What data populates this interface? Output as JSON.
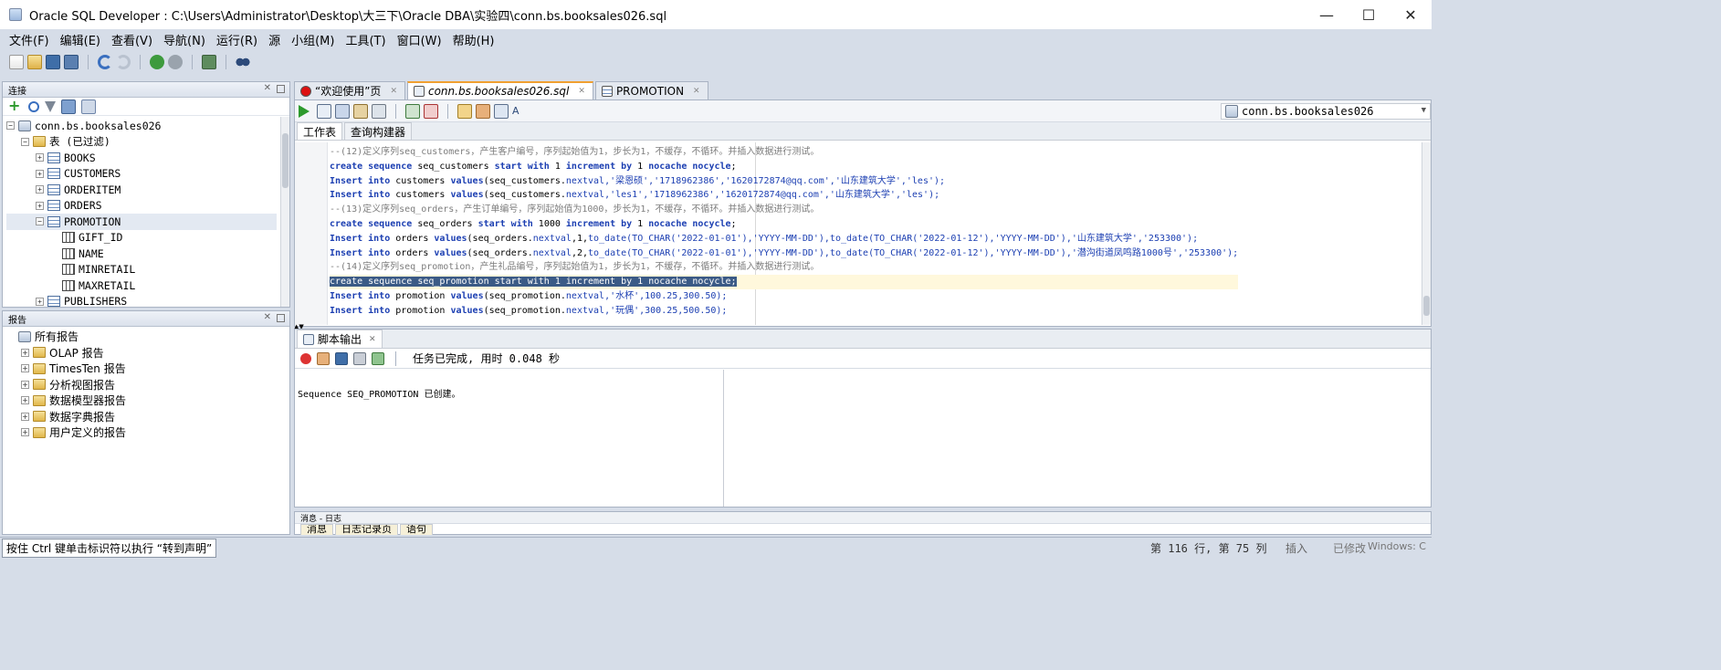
{
  "window": {
    "title": "Oracle SQL Developer : C:\\Users\\Administrator\\Desktop\\大三下\\Oracle DBA\\实验四\\conn.bs.booksales026.sql",
    "minimize": "—",
    "maximize": "☐",
    "close": "✕"
  },
  "menu": [
    "文件(F)",
    "编辑(E)",
    "查看(V)",
    "导航(N)",
    "运行(R)",
    "源",
    "小组(M)",
    "工具(T)",
    "窗口(W)",
    "帮助(H)"
  ],
  "connections_panel": {
    "title": "连接",
    "tree": [
      {
        "label": "conn.bs.booksales026",
        "level": 0,
        "expander": "−",
        "icon": "database-icon"
      },
      {
        "label": "表 (已过滤)",
        "level": 1,
        "expander": "−",
        "icon": "folder-icon"
      },
      {
        "label": "BOOKS",
        "level": 2,
        "expander": "+",
        "icon": "table-icon"
      },
      {
        "label": "CUSTOMERS",
        "level": 2,
        "expander": "+",
        "icon": "table-icon"
      },
      {
        "label": "ORDERITEM",
        "level": 2,
        "expander": "+",
        "icon": "table-icon"
      },
      {
        "label": "ORDERS",
        "level": 2,
        "expander": "+",
        "icon": "table-icon"
      },
      {
        "label": "PROMOTION",
        "level": 2,
        "expander": "−",
        "icon": "table-icon",
        "selected": true
      },
      {
        "label": "GIFT_ID",
        "level": 3,
        "expander": "",
        "icon": "column-icon"
      },
      {
        "label": "NAME",
        "level": 3,
        "expander": "",
        "icon": "column-icon"
      },
      {
        "label": "MINRETAIL",
        "level": 3,
        "expander": "",
        "icon": "column-icon"
      },
      {
        "label": "MAXRETAIL",
        "level": 3,
        "expander": "",
        "icon": "column-icon"
      },
      {
        "label": "PUBLISHERS",
        "level": 2,
        "expander": "+",
        "icon": "table-icon"
      }
    ]
  },
  "reports_panel": {
    "title": "报告",
    "tree": [
      {
        "label": "所有报告",
        "level": 0,
        "expander": "",
        "icon": "report-icon"
      },
      {
        "label": "OLAP 报告",
        "level": 1,
        "expander": "+",
        "icon": "folder-icon"
      },
      {
        "label": "TimesTen 报告",
        "level": 1,
        "expander": "+",
        "icon": "folder-icon"
      },
      {
        "label": "分析视图报告",
        "level": 1,
        "expander": "+",
        "icon": "folder-icon"
      },
      {
        "label": "数据模型器报告",
        "level": 1,
        "expander": "+",
        "icon": "folder-icon"
      },
      {
        "label": "数据字典报告",
        "level": 1,
        "expander": "+",
        "icon": "folder-icon"
      },
      {
        "label": "用户定义的报告",
        "level": 1,
        "expander": "+",
        "icon": "folder-icon"
      }
    ]
  },
  "doc_tabs": [
    {
      "label": "“欢迎使用”页",
      "icon": "oracle-icon",
      "active": false
    },
    {
      "label": "conn.bs.booksales026.sql",
      "icon": "sql-worksheet-icon",
      "active": true
    },
    {
      "label": "PROMOTION",
      "icon": "table-icon",
      "active": false
    }
  ],
  "editor": {
    "connection": "conn.bs.booksales026",
    "subtabs": [
      "工作表",
      "查询构建器"
    ],
    "lines": [
      [
        {
          "t": "--(12)定义序列seq_customers，产生客户编号，序列起始值为1，步长为1，不缓存，不循环。并插入数据进行测试。",
          "c": "cmt"
        }
      ],
      [
        {
          "t": "create sequence",
          "c": "kw"
        },
        {
          "t": " seq_customers ",
          "c": "plain"
        },
        {
          "t": "start with",
          "c": "kw"
        },
        {
          "t": " 1 ",
          "c": "plain"
        },
        {
          "t": "increment by",
          "c": "kw"
        },
        {
          "t": " 1 ",
          "c": "plain"
        },
        {
          "t": "nocache nocycle",
          "c": "kw"
        },
        {
          "t": ";",
          "c": "plain"
        }
      ],
      [
        {
          "t": "Insert into",
          "c": "kw"
        },
        {
          "t": " customers ",
          "c": "plain"
        },
        {
          "t": "values",
          "c": "kw"
        },
        {
          "t": "(seq_customers.",
          "c": "plain"
        },
        {
          "t": "nextval",
          "c": "fn"
        },
        {
          "t": ",'梁恩硕','1718962386','1620172874@qq.com','山东建筑大学','les');",
          "c": "str"
        }
      ],
      [
        {
          "t": "Insert into",
          "c": "kw"
        },
        {
          "t": " customers ",
          "c": "plain"
        },
        {
          "t": "values",
          "c": "kw"
        },
        {
          "t": "(seq_customers.",
          "c": "plain"
        },
        {
          "t": "nextval",
          "c": "fn"
        },
        {
          "t": ",'les1','1718962386','1620172874@qq.com','山东建筑大学','les');",
          "c": "str"
        }
      ],
      [
        {
          "t": "--(13)定义序列seq_orders，产生订单编号，序列起始值为1000，步长为1，不缓存，不循环。并插入数据进行测试。",
          "c": "cmt"
        }
      ],
      [
        {
          "t": "create sequence",
          "c": "kw"
        },
        {
          "t": " seq_orders ",
          "c": "plain"
        },
        {
          "t": "start with",
          "c": "kw"
        },
        {
          "t": " 1000 ",
          "c": "plain"
        },
        {
          "t": "increment by",
          "c": "kw"
        },
        {
          "t": " 1 ",
          "c": "plain"
        },
        {
          "t": "nocache nocycle",
          "c": "kw"
        },
        {
          "t": ";",
          "c": "plain"
        }
      ],
      [
        {
          "t": "Insert into",
          "c": "kw"
        },
        {
          "t": " orders ",
          "c": "plain"
        },
        {
          "t": "values",
          "c": "kw"
        },
        {
          "t": "(seq_orders.",
          "c": "plain"
        },
        {
          "t": "nextval",
          "c": "fn"
        },
        {
          "t": ",1,",
          "c": "plain"
        },
        {
          "t": "to_date",
          "c": "fn"
        },
        {
          "t": "(TO_CHAR('2022-01-01'),'YYYY-MM-DD'),",
          "c": "str"
        },
        {
          "t": "to_date",
          "c": "fn"
        },
        {
          "t": "(TO_CHAR('2022-01-12'),'YYYY-MM-DD'),'山东建筑大学','253300');",
          "c": "str"
        }
      ],
      [
        {
          "t": "Insert into",
          "c": "kw"
        },
        {
          "t": " orders ",
          "c": "plain"
        },
        {
          "t": "values",
          "c": "kw"
        },
        {
          "t": "(seq_orders.",
          "c": "plain"
        },
        {
          "t": "nextval",
          "c": "fn"
        },
        {
          "t": ",2,",
          "c": "plain"
        },
        {
          "t": "to_date",
          "c": "fn"
        },
        {
          "t": "(TO_CHAR('2022-01-01'),'YYYY-MM-DD'),",
          "c": "str"
        },
        {
          "t": "to_date",
          "c": "fn"
        },
        {
          "t": "(TO_CHAR('2022-01-12'),'YYYY-MM-DD'),'潜沟街道凤鸣路1000号','253300');",
          "c": "str"
        }
      ],
      [
        {
          "t": "--(14)定义序列seq_promotion，产生礼品编号，序列起始值为1，步长为1，不缓存，不循环。并插入数据进行测试。",
          "c": "cmt"
        }
      ],
      [
        {
          "t": "create sequence seq_promotion start with 1 increment by 1 nocache nocycle;",
          "c": "hl"
        }
      ],
      [
        {
          "t": "Insert into",
          "c": "kw"
        },
        {
          "t": " promotion ",
          "c": "plain"
        },
        {
          "t": "values",
          "c": "kw"
        },
        {
          "t": "(seq_promotion.",
          "c": "plain"
        },
        {
          "t": "nextval",
          "c": "fn"
        },
        {
          "t": ",'水杯',100.25,300.50);",
          "c": "str"
        }
      ],
      [
        {
          "t": "Insert into",
          "c": "kw"
        },
        {
          "t": " promotion ",
          "c": "plain"
        },
        {
          "t": "values",
          "c": "kw"
        },
        {
          "t": "(seq_promotion.",
          "c": "plain"
        },
        {
          "t": "nextval",
          "c": "fn"
        },
        {
          "t": ",'玩偶',300.25,500.50);",
          "c": "str"
        }
      ]
    ]
  },
  "script_output": {
    "tab_label": "脚本输出",
    "status": "任务已完成, 用时 0.048 秒",
    "text": "Sequence SEQ_PROMOTION 已创建。"
  },
  "message_log": {
    "title": "消息 - 日志",
    "tabs": [
      "消息",
      "日志记录页",
      "语句"
    ]
  },
  "statusbar": {
    "hint": "按住 Ctrl 键单击标识符以执行 “转到声明”",
    "position": "第 116 行, 第 75 列",
    "mode": "插入",
    "modified": "已修改",
    "eol": "Windows: C"
  },
  "colors": {
    "keyword": "#1c3fb2",
    "comment": "#7d7d7d",
    "selection": "#3b5a86",
    "chrome": "#d6dde8"
  }
}
